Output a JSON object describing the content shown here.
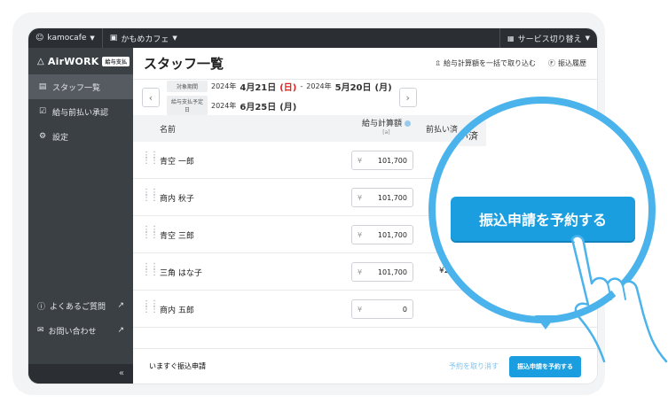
{
  "topbar": {
    "account": "kamocafe",
    "store": "かもめカフェ",
    "service_switch": "サービス切り替え"
  },
  "sidebar": {
    "logo_text": "AirWORK",
    "logo_badge": "給与支払",
    "items": [
      {
        "label": "スタッフ一覧",
        "icon": "staff-list-icon",
        "active": true
      },
      {
        "label": "給与前払い承認",
        "icon": "approval-icon",
        "active": false
      },
      {
        "label": "設定",
        "icon": "gear-icon",
        "active": false
      }
    ],
    "faq": "よくあるご質問",
    "contact": "お問い合わせ",
    "collapse": "«"
  },
  "header": {
    "title": "スタッフ一覧",
    "bulk_import": "給与計算額を一括で取り込む",
    "transfer_history": "振込履歴"
  },
  "period": {
    "target_label": "対象期間",
    "target_year1": "2024年",
    "target_date1": "4月21日",
    "target_day1": "(日)",
    "separator": "-",
    "target_year2": "2024年",
    "target_date2": "5月20日",
    "target_day2": "(月)",
    "pay_label": "給与支払予定日",
    "pay_year": "2024年",
    "pay_date": "6月25日",
    "pay_day": "(月)"
  },
  "table": {
    "col_name": "名前",
    "col_amount": "給与計算額",
    "col_amount_sub": "[a]",
    "col_paid": "前払い済",
    "rows": [
      {
        "name": "青空 一郎",
        "amount": "101,700",
        "paid": ""
      },
      {
        "name": "商内 秋子",
        "amount": "101,700",
        "paid": ""
      },
      {
        "name": "青空 三郎",
        "amount": "101,700",
        "paid": ""
      },
      {
        "name": "三角 はな子",
        "amount": "101,700",
        "paid": "¥2"
      },
      {
        "name": "商内 五郎",
        "amount": "0",
        "paid": "-"
      }
    ],
    "currency": "¥"
  },
  "footer": {
    "immediate": "いますぐ振込申請",
    "cancel": "予約を取り消す",
    "reserve": "振込申請を予約する"
  },
  "magnifier": {
    "paid_partial": "前払い済",
    "button": "振込申請を予約する"
  },
  "colors": {
    "accent": "#1a9ee0",
    "magnifier_ring": "#4bb3ec",
    "sidebar": "#3b4045",
    "topbar": "#2b2f33"
  }
}
